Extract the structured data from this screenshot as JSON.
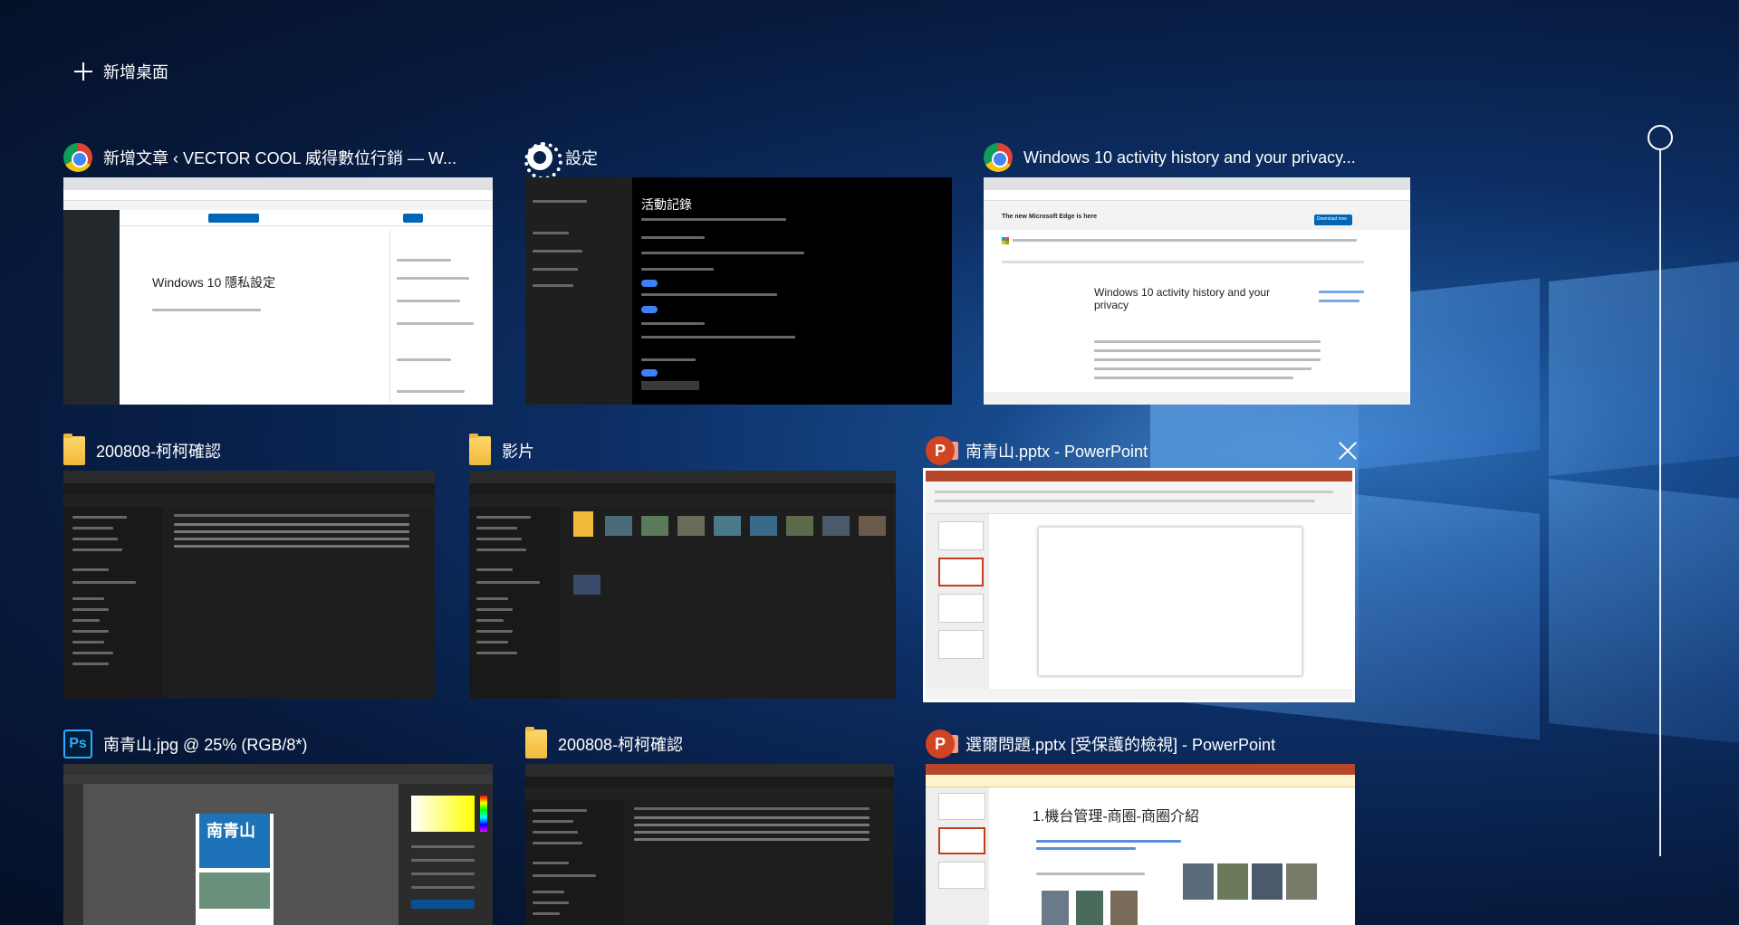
{
  "new_desktop": {
    "label": "新增桌面"
  },
  "windows": [
    {
      "app": "chrome",
      "title": "新增文章 ‹ VECTOR COOL 威得數位行銷 — W...",
      "doc_heading": "Windows 10 隱私設定"
    },
    {
      "app": "settings",
      "title": "設定",
      "doc_heading": "活動記錄"
    },
    {
      "app": "chrome",
      "title": "Windows 10 activity history and your privacy...",
      "banner": "The new Microsoft Edge is here",
      "banner_button": "Download now",
      "doc_heading": "Windows 10 activity history and your privacy"
    },
    {
      "app": "explorer",
      "title": "200808-柯柯確認"
    },
    {
      "app": "explorer",
      "title": "影片"
    },
    {
      "app": "powerpoint",
      "title": "南青山.pptx - PowerPoint",
      "selected": true
    },
    {
      "app": "photoshop",
      "title": "南青山.jpg @ 25% (RGB/8*)",
      "poster_text": "南青山"
    },
    {
      "app": "explorer",
      "title": "200808-柯柯確認"
    },
    {
      "app": "powerpoint",
      "title": "選爾問題.pptx [受保護的檢視] - PowerPoint",
      "slide_heading": "1.機台管理-商圈-商圈介紹"
    }
  ]
}
